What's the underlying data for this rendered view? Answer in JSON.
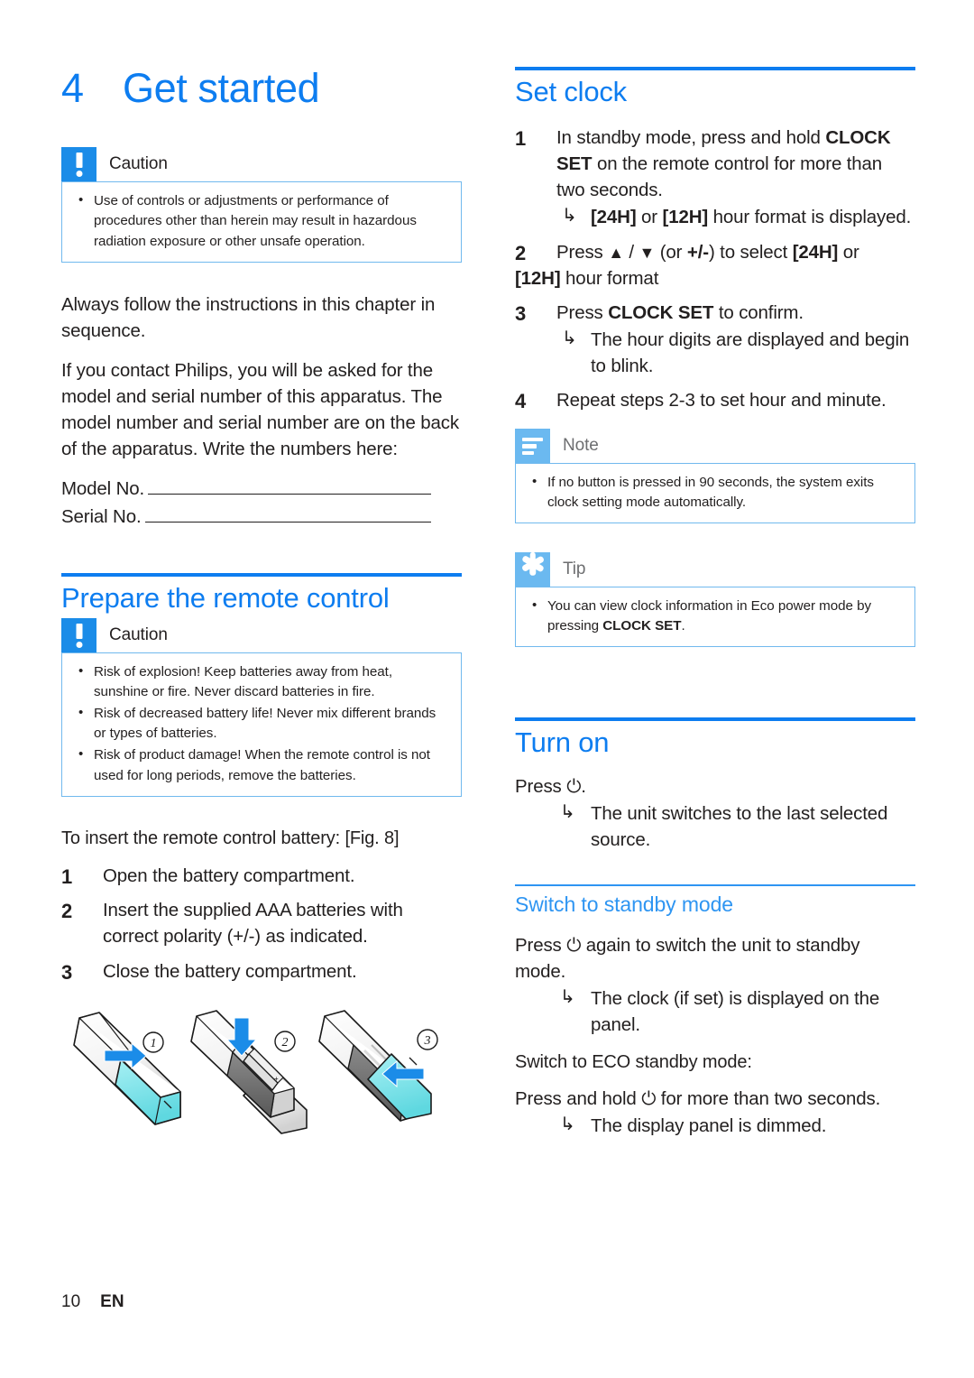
{
  "page": {
    "number": "10",
    "language": "EN"
  },
  "chapter": {
    "number": "4",
    "title": "Get started"
  },
  "left_column": {
    "caution_top": {
      "title": "Caution",
      "icon": "exclamation-icon",
      "items": [
        "Use of controls or adjustments or performance of procedures other than herein may result in hazardous radiation exposure or other unsafe operation."
      ]
    },
    "intro_paragraphs": [
      "Always follow the instructions in this chapter in sequence.",
      "If you contact Philips, you will be asked for the model and serial number of this apparatus. The model number and serial number are on the back of the apparatus. Write the numbers here:"
    ],
    "fill_in": [
      {
        "label": "Model No."
      },
      {
        "label": "Serial No."
      }
    ],
    "prepare_section": {
      "heading": "Prepare the remote control",
      "caution": {
        "title": "Caution",
        "icon": "exclamation-icon",
        "items": [
          "Risk of explosion! Keep batteries away from heat, sunshine or fire. Never discard batteries in fire.",
          "Risk of decreased battery life! Never mix different brands or types of batteries.",
          "Risk of product damage! When the remote control is not used for long periods, remove the batteries."
        ]
      },
      "procedure_title": "To insert the remote control battery: [Fig. 8]",
      "steps": [
        "Open the battery compartment.",
        "Insert the supplied AAA batteries with correct polarity (+/-) as indicated.",
        "Close the battery compartment."
      ]
    },
    "figure": {
      "name": "remote-control-battery-figure",
      "callout_labels": [
        "1",
        "2",
        "3"
      ]
    }
  },
  "right_column": {
    "set_clock": {
      "heading": "Set clock",
      "steps": [
        {
          "text_parts": [
            {
              "t": "In standby mode, press and hold ",
              "b": false
            },
            {
              "t": "CLOCK SET",
              "b": true
            },
            {
              "t": " on the remote control for more than two seconds.",
              "b": false
            }
          ],
          "result": "[24H] or [12H] hour format is displayed.",
          "result_bold_tokens": [
            "[24H]",
            "[12H]"
          ]
        },
        {
          "text_parts": [
            {
              "t": "Press ",
              "b": false
            },
            {
              "t": "▲ / ▼",
              "b": false
            },
            {
              "t": " (or ",
              "b": false
            },
            {
              "t": "+/-",
              "b": true
            },
            {
              "t": ") to select ",
              "b": false
            },
            {
              "t": "[24H]",
              "b": true
            },
            {
              "t": " or ",
              "b": false
            },
            {
              "t": "[12H]",
              "b": true
            },
            {
              "t": " hour format",
              "b": false
            }
          ],
          "result": null
        },
        {
          "text_parts": [
            {
              "t": "Press ",
              "b": false
            },
            {
              "t": "CLOCK SET",
              "b": true
            },
            {
              "t": " to confirm.",
              "b": false
            }
          ],
          "result": "The hour digits are displayed and begin to blink."
        },
        {
          "text_parts": [
            {
              "t": "Repeat steps 2-3 to set hour and minute.",
              "b": false
            }
          ],
          "result": null
        }
      ],
      "note": {
        "title": "Note",
        "icon": "note-lines-icon",
        "items": [
          "If no button is pressed in 90 seconds, the system exits clock setting mode automatically."
        ]
      },
      "tip": {
        "title": "Tip",
        "icon": "asterisk-icon",
        "items_parts": [
          [
            {
              "t": "You can view clock information in Eco power mode by pressing ",
              "b": false
            },
            {
              "t": "CLOCK SET",
              "b": true
            },
            {
              "t": ".",
              "b": false
            }
          ]
        ]
      }
    },
    "turn_on": {
      "heading": "Turn on",
      "instruction": "Press ⏻.",
      "result": "The unit switches to the last selected source."
    },
    "standby": {
      "heading": "Switch to standby mode",
      "instruction": " Press ⏻ again to switch the unit to standby mode.",
      "result": "The clock (if set) is displayed on the panel.",
      "eco_heading": "Switch to ECO standby mode:",
      "eco_instruction": "Press and hold ⏻ for more than two seconds.",
      "eco_result": "The display panel is dimmed."
    }
  },
  "colors": {
    "heading_blue": "#0d7df0",
    "sub_heading_blue": "#2e95f2",
    "caution_badge": "#1b8ce8",
    "note_badge": "#6bb9f0",
    "rule_blue": "#0d7df0",
    "box_border": "#71b9ee",
    "figure_cyan": "#7fe3e8",
    "figure_arrow": "#1b8ce8"
  }
}
